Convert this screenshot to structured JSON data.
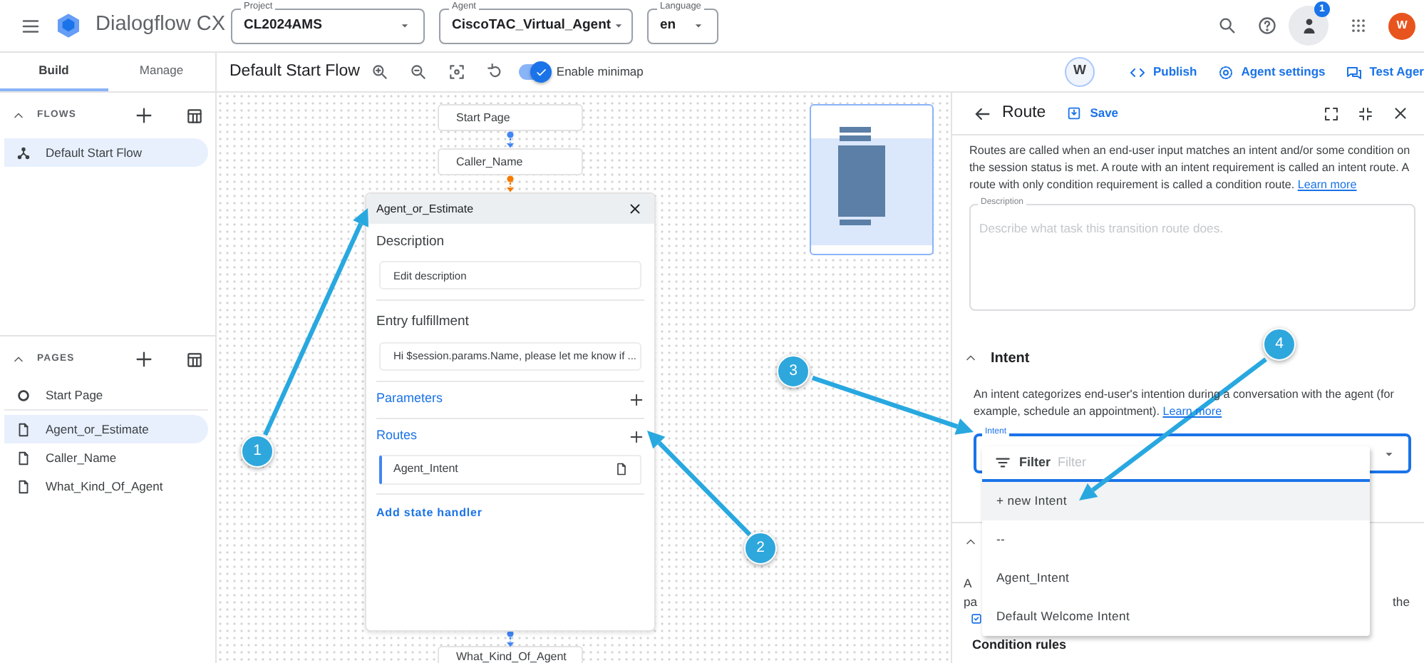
{
  "app": {
    "title": "Dialogflow CX"
  },
  "selectors": [
    {
      "label": "Project",
      "value": "CL2024AMS"
    },
    {
      "label": "Agent",
      "value": "CiscoTAC_Virtual_Agent"
    },
    {
      "label": "Language",
      "value": "en"
    }
  ],
  "notifications": {
    "badge": "1"
  },
  "account": {
    "avatar": "W"
  },
  "side_tabs": [
    {
      "label": "Build",
      "selected": true
    },
    {
      "label": "Manage",
      "selected": false
    }
  ],
  "toolbar": {
    "flow_title": "Default Start Flow",
    "minimap_toggle": {
      "label": "Enable minimap",
      "on": true
    },
    "user_badge": "W",
    "actions": [
      {
        "kind": "publish",
        "label": "Publish"
      },
      {
        "kind": "settings",
        "label": "Agent settings"
      },
      {
        "kind": "test",
        "label": "Test Ager"
      }
    ]
  },
  "sidebar": {
    "flows": {
      "title": "FLOWS",
      "expanded": true,
      "items": [
        {
          "label": "Default Start Flow",
          "kind": "flow",
          "selected": true
        }
      ]
    },
    "pages": {
      "title": "PAGES",
      "expanded": true,
      "items": [
        {
          "label": "Start Page",
          "kind": "start",
          "selected": false
        },
        {
          "label": "Agent_or_Estimate",
          "kind": "page",
          "selected": true
        },
        {
          "label": "Caller_Name",
          "kind": "page",
          "selected": false
        },
        {
          "label": "What_Kind_Of_Agent",
          "kind": "page",
          "selected": false
        }
      ]
    }
  },
  "canvas": {
    "nodes": [
      {
        "label": "Start Page"
      },
      {
        "label": "Caller_Name",
        "color": "#4285f4"
      },
      {
        "label": "What_Kind_Of_Agent",
        "color": "#4285f4"
      }
    ],
    "page_panel": {
      "title": "Agent_or_Estimate",
      "color": "#f57c00",
      "description": {
        "label": "Description",
        "value": "Edit description"
      },
      "fulfillment": {
        "label": "Entry fulfillment",
        "value": "Hi $session.params.Name, please let me know if ..."
      },
      "parameters": "Parameters",
      "routes": {
        "label": "Routes",
        "items": [
          "Agent_Intent"
        ]
      },
      "add_handler": "Add state handler"
    }
  },
  "route_panel": {
    "title": "Route",
    "save": "Save",
    "intro": "Routes are called when an end-user input matches an intent and/or some condition on the session status is met. A route with an intent requirement is called an intent route. A route with only condition requirement is called a condition route.",
    "intro_link": "Learn more",
    "description": {
      "label": "Description",
      "placeholder": "Describe what task this transition route does."
    },
    "intent_section": {
      "title": "Intent",
      "expanded": true,
      "text": "An intent categorizes end-user's intention during a conversation with the agent (for example, schedule an appointment).",
      "link": "Learn more",
      "field_label": "Intent"
    },
    "condition_section": {
      "expanded": true,
      "fragments": [
        "A",
        "pa",
        "the"
      ],
      "title": "Condition rules"
    },
    "dropdown": {
      "filter_label": "Filter",
      "filter_placeholder": "Filter",
      "options": [
        {
          "label": "+ new Intent",
          "highlighted": true
        },
        {
          "label": "--",
          "highlighted": false
        },
        {
          "label": "Agent_Intent",
          "highlighted": false
        },
        {
          "label": "Default Welcome Intent",
          "highlighted": false
        }
      ]
    }
  },
  "callouts": [
    {
      "label": "1"
    },
    {
      "label": "2"
    },
    {
      "label": "3"
    },
    {
      "label": "4"
    }
  ]
}
